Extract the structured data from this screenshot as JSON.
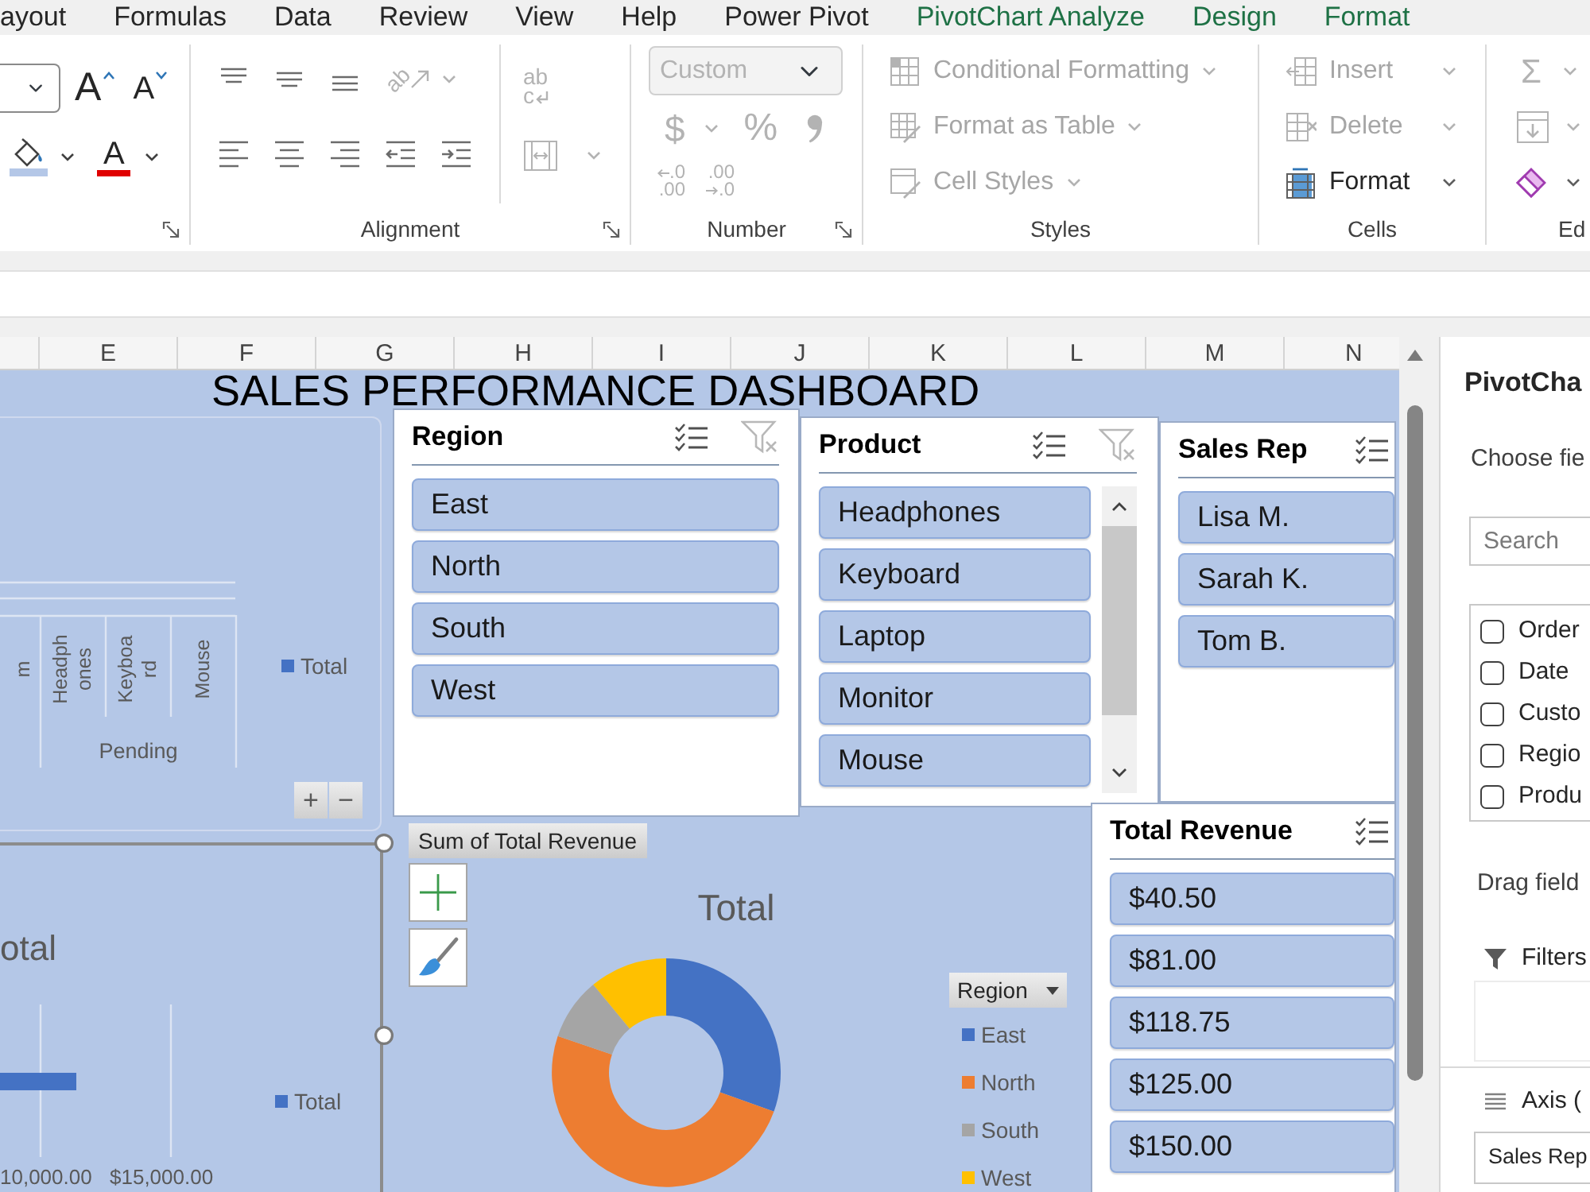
{
  "ribbon_tabs": [
    {
      "label": "ayout",
      "kind": "standard",
      "selected": false
    },
    {
      "label": "Formulas",
      "kind": "standard",
      "selected": false
    },
    {
      "label": "Data",
      "kind": "standard",
      "selected": false
    },
    {
      "label": "Review",
      "kind": "standard",
      "selected": false
    },
    {
      "label": "View",
      "kind": "standard",
      "selected": false
    },
    {
      "label": "Help",
      "kind": "standard",
      "selected": false
    },
    {
      "label": "Power Pivot",
      "kind": "standard",
      "selected": false
    },
    {
      "label": "PivotChart Analyze",
      "kind": "contextual",
      "selected": false
    },
    {
      "label": "Design",
      "kind": "contextual",
      "selected": false
    },
    {
      "label": "Format",
      "kind": "contextual",
      "selected": false
    }
  ],
  "ribbon": {
    "font_group": {
      "grow_font": {
        "glyph": "A"
      },
      "shrink_font": {
        "glyph": "A"
      },
      "font_color": {
        "glyph": "A"
      }
    },
    "alignment_group": {
      "label": "Alignment",
      "orientation": {
        "glyph": "ab",
        "disabled": true
      },
      "wrap_text": {
        "lines": [
          "ab",
          "c"
        ],
        "disabled": true
      },
      "merge": {
        "disabled": true
      }
    },
    "number_group": {
      "label": "Number",
      "format_field": {
        "value": "Custom",
        "disabled": true
      },
      "currency": {
        "glyph": "$",
        "disabled": true
      },
      "percent": {
        "glyph": "%",
        "disabled": true
      },
      "comma": {
        "disabled": true
      },
      "increase_decimal": {
        "lines": [
          ".0",
          ".00"
        ],
        "disabled": true
      },
      "decrease_decimal": {
        "lines": [
          ".00",
          ".0"
        ],
        "disabled": true
      }
    },
    "styles_group": {
      "label": "Styles",
      "commands": [
        {
          "label": "Conditional Formatting",
          "disabled": true
        },
        {
          "label": "Format as Table",
          "disabled": true
        },
        {
          "label": "Cell Styles",
          "disabled": true
        }
      ]
    },
    "cells_group": {
      "label": "Cells",
      "commands": [
        {
          "label": "Insert",
          "disabled": true
        },
        {
          "label": "Delete",
          "disabled": true
        },
        {
          "label": "Format",
          "disabled": false
        }
      ]
    },
    "editing_group": {
      "label": "Ed",
      "autosum": {
        "glyph": "Σ",
        "disabled": true
      },
      "fill": {
        "disabled": true
      },
      "clear": {
        "disabled": false
      }
    }
  },
  "column_headers": [
    "E",
    "F",
    "G",
    "H",
    "I",
    "J",
    "K",
    "L",
    "M",
    "N"
  ],
  "sheet": {
    "title": "SALES PERFORMANCE DASHBOARD",
    "charts": [
      {
        "kind": "column",
        "selected": false,
        "category_labels": [
          [
            "m"
          ],
          [
            "Headph",
            "ones"
          ],
          [
            "Keyboa",
            "rd"
          ],
          [
            "Mouse"
          ]
        ],
        "group_label": "Pending",
        "legend": "Total",
        "field_buttons": [
          "+",
          "−"
        ]
      },
      {
        "kind": "bar",
        "selected": true,
        "title": "otal",
        "legend": "Total",
        "tick_labels": [
          "10,000.00",
          "$15,000.00"
        ]
      },
      {
        "kind": "donut",
        "selected": false,
        "field_button": "Sum of Total Revenue",
        "chart_data": {
          "type": "donut",
          "title": "Total",
          "legend_title": "Region",
          "categories": [
            "East",
            "North",
            "South",
            "West"
          ],
          "values": [
            30.5,
            49.7,
            8.8,
            11.0
          ],
          "colors": [
            "#4472c4",
            "#ed7d31",
            "#a5a5a5",
            "#ffc000"
          ]
        }
      }
    ],
    "slicers": [
      {
        "title": "Region",
        "items": [
          {
            "label": "East",
            "selected": true
          },
          {
            "label": "North",
            "selected": true
          },
          {
            "label": "South",
            "selected": true
          },
          {
            "label": "West",
            "selected": true
          }
        ]
      },
      {
        "title": "Product",
        "scrollbar": true,
        "items": [
          {
            "label": "Headphones",
            "selected": true
          },
          {
            "label": "Keyboard",
            "selected": true
          },
          {
            "label": "Laptop",
            "selected": true
          },
          {
            "label": "Monitor",
            "selected": true
          },
          {
            "label": "Mouse",
            "selected": true
          }
        ]
      },
      {
        "title": "Sales Rep",
        "items": [
          {
            "label": "Lisa M.",
            "selected": true
          },
          {
            "label": "Sarah K.",
            "selected": true
          },
          {
            "label": "Tom B.",
            "selected": true
          }
        ]
      },
      {
        "title": "Total Revenue",
        "items": [
          {
            "label": "$40.50",
            "selected": true
          },
          {
            "label": "$81.00",
            "selected": true
          },
          {
            "label": "$118.75",
            "selected": true
          },
          {
            "label": "$125.00",
            "selected": true
          },
          {
            "label": "$150.00",
            "selected": true
          }
        ]
      }
    ]
  },
  "field_list": {
    "title": "PivotCha",
    "subtitle": "Choose fie",
    "search": {
      "placeholder": "Search"
    },
    "fields": [
      {
        "label": "Order",
        "checked": false
      },
      {
        "label": "Date",
        "checked": false
      },
      {
        "label": "Custo",
        "checked": false
      },
      {
        "label": "Regio",
        "checked": false
      },
      {
        "label": "Produ",
        "checked": false
      }
    ],
    "drag_hint": "Drag field",
    "areas": [
      {
        "kind": "filters",
        "label": "Filters"
      },
      {
        "kind": "axis",
        "label": "Axis (",
        "items": [
          "Sales Rep"
        ]
      }
    ]
  }
}
